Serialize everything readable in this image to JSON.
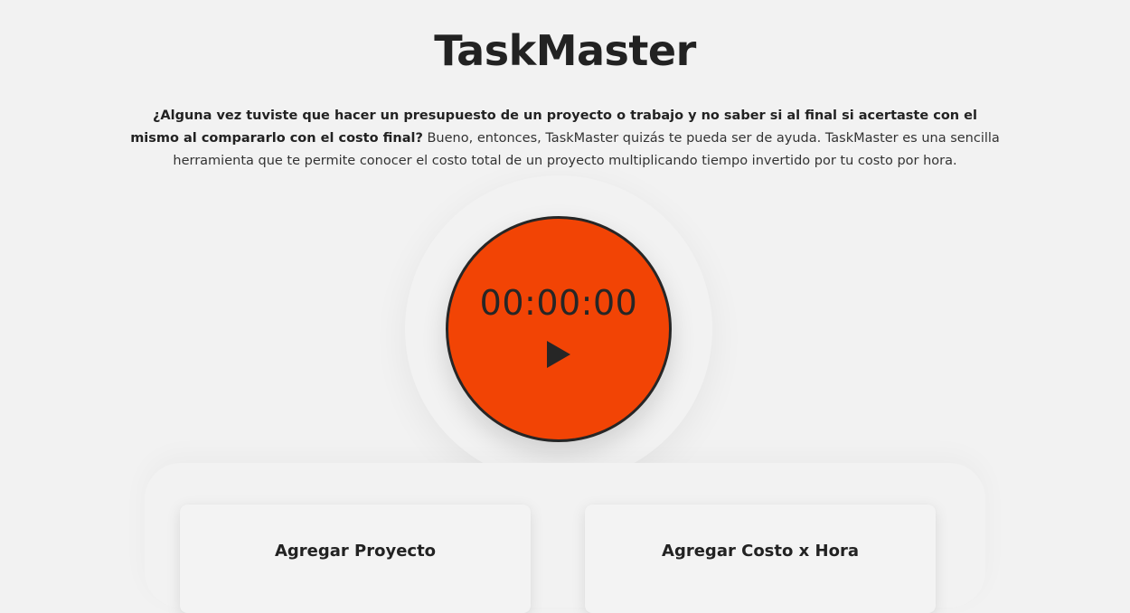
{
  "header": {
    "title": "TaskMaster"
  },
  "intro": {
    "bold_text": "¿Alguna vez tuviste que hacer un presupuesto de un proyecto o trabajo y no saber si al final si acertaste con el mismo al compararlo con el costo final?",
    "body_text": " Bueno, entonces, TaskMaster quizás te pueda ser de ayuda. TaskMaster es una sencilla herramienta que te permite conocer el costo total de un proyecto multiplicando tiempo invertido por tu costo por hora."
  },
  "timer": {
    "display": "00:00:00",
    "play_icon": "play-icon",
    "accent_color": "#f24405"
  },
  "cards": {
    "project": {
      "title": "Agregar Proyecto"
    },
    "cost": {
      "title": "Agregar Costo x Hora"
    }
  }
}
